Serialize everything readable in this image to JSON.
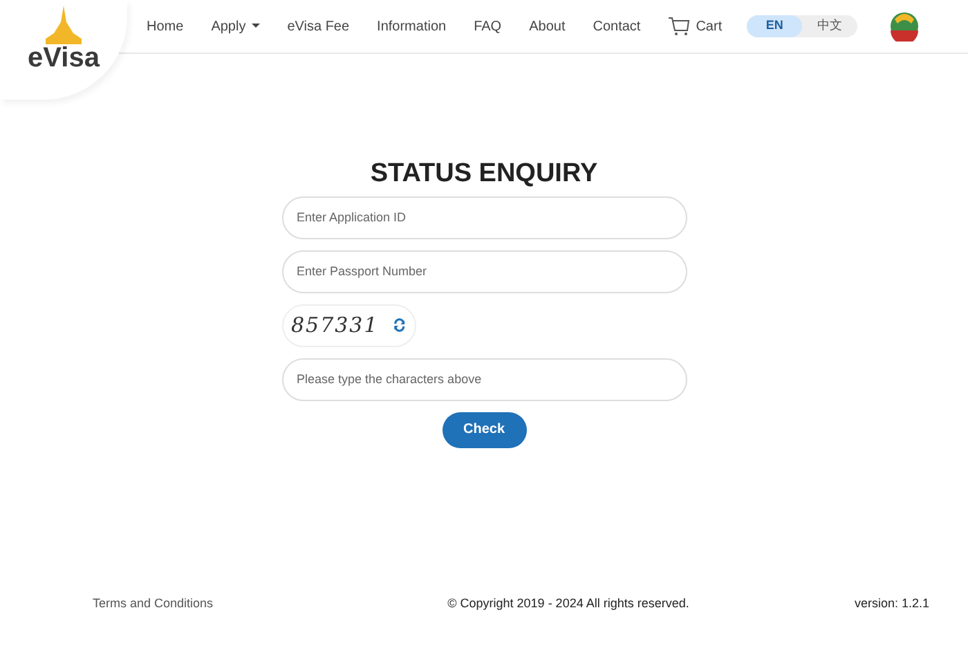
{
  "header": {
    "logo_text": "eVisa",
    "nav": [
      {
        "label": "Home",
        "kind": "link"
      },
      {
        "label": "Apply",
        "kind": "dropdown"
      },
      {
        "label": "eVisa Fee",
        "kind": "link"
      },
      {
        "label": "Information",
        "kind": "link"
      },
      {
        "label": "FAQ",
        "kind": "link"
      },
      {
        "label": "About",
        "kind": "link"
      },
      {
        "label": "Contact",
        "kind": "link"
      },
      {
        "label": "Cart",
        "kind": "cart"
      }
    ],
    "languages": [
      {
        "label": "EN",
        "selected": true
      },
      {
        "label": "中文",
        "selected": false
      }
    ]
  },
  "form": {
    "title": "STATUS ENQUIRY",
    "fields": [
      {
        "placeholder": "Enter Application ID"
      },
      {
        "placeholder": "Enter Passport Number"
      }
    ],
    "captcha": "857331",
    "captcha_field": {
      "placeholder": "Please type the characters above"
    },
    "button": "Check"
  },
  "footer": {
    "terms": "Terms and Conditions",
    "copyright": "© Copyright 2019 - 2024 All rights reserved.",
    "version": "version: 1.2.1"
  }
}
